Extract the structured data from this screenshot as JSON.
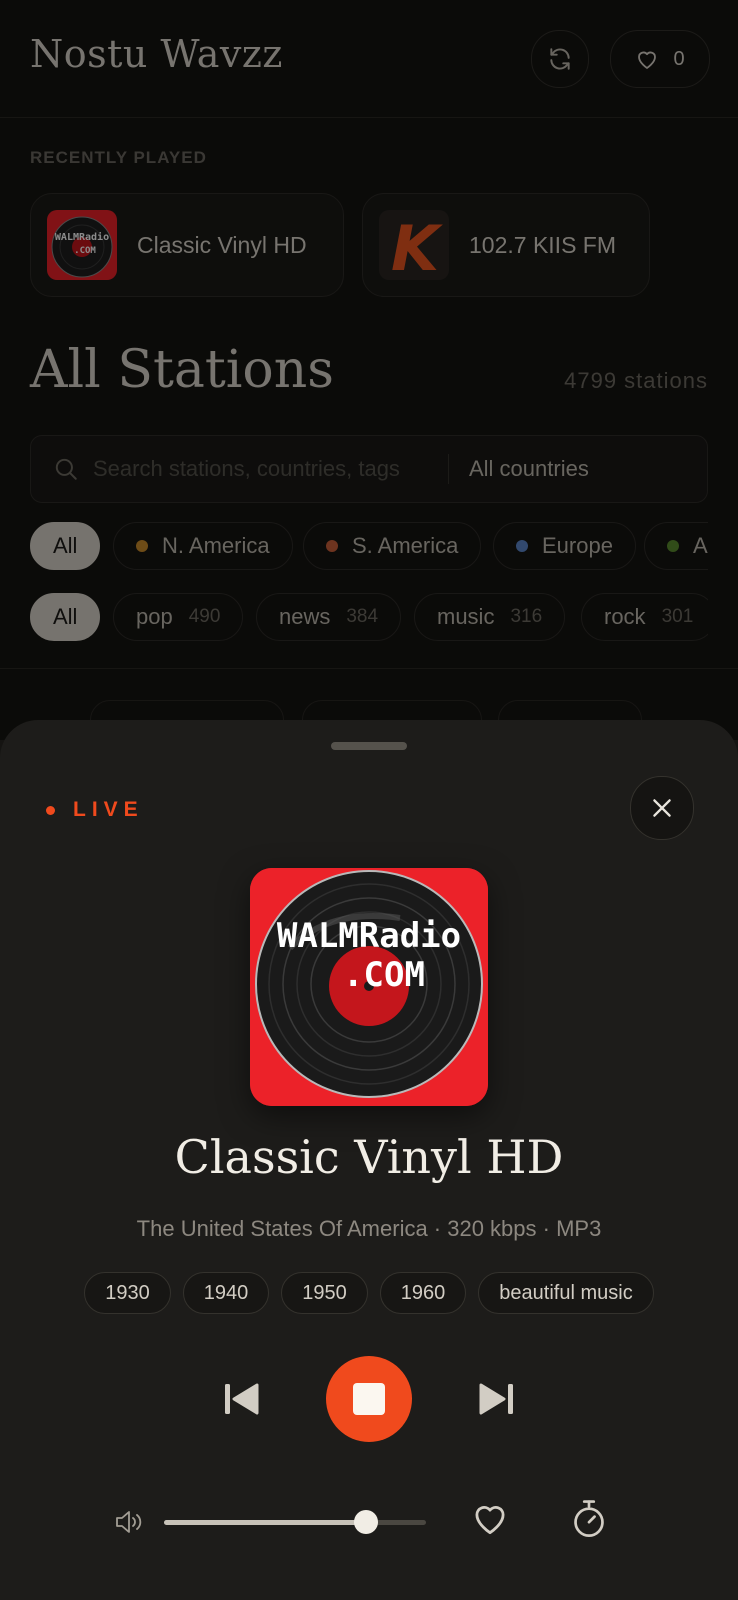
{
  "header": {
    "app_title": "Nostu Wavzz",
    "favorites_count": "0"
  },
  "recent": {
    "label": "RECENTLY PLAYED",
    "items": [
      {
        "name": "Classic Vinyl HD",
        "art_text_1": "WALMRadio",
        "art_text_2": ".COM"
      },
      {
        "name": "102.7 KIIS FM",
        "art_letter": "K"
      }
    ]
  },
  "stations": {
    "title": "All Stations",
    "count": "4799 stations"
  },
  "search": {
    "placeholder": "Search stations, countries, tags",
    "country": "All countries"
  },
  "regions": [
    {
      "label": "All",
      "active": true
    },
    {
      "label": "N. America",
      "color": "#c98a2a"
    },
    {
      "label": "S. America",
      "color": "#c8603a"
    },
    {
      "label": "Europe",
      "color": "#5b86c9"
    },
    {
      "label": "A",
      "color": "#5a8a2e"
    }
  ],
  "genres": [
    {
      "label": "All",
      "active": true
    },
    {
      "label": "pop",
      "count": "490"
    },
    {
      "label": "news",
      "count": "384"
    },
    {
      "label": "music",
      "count": "316"
    },
    {
      "label": "rock",
      "count": "301"
    }
  ],
  "player": {
    "live_label": "LIVE",
    "art_text_1": "WALMRadio",
    "art_text_2": ".COM",
    "station_name": "Classic Vinyl HD",
    "meta": "The United States Of America · 320 kbps · MP3",
    "tags": [
      "1930",
      "1940",
      "1950",
      "1960",
      "beautiful music"
    ],
    "volume": 0.77,
    "accent_color": "#f04a1d"
  }
}
